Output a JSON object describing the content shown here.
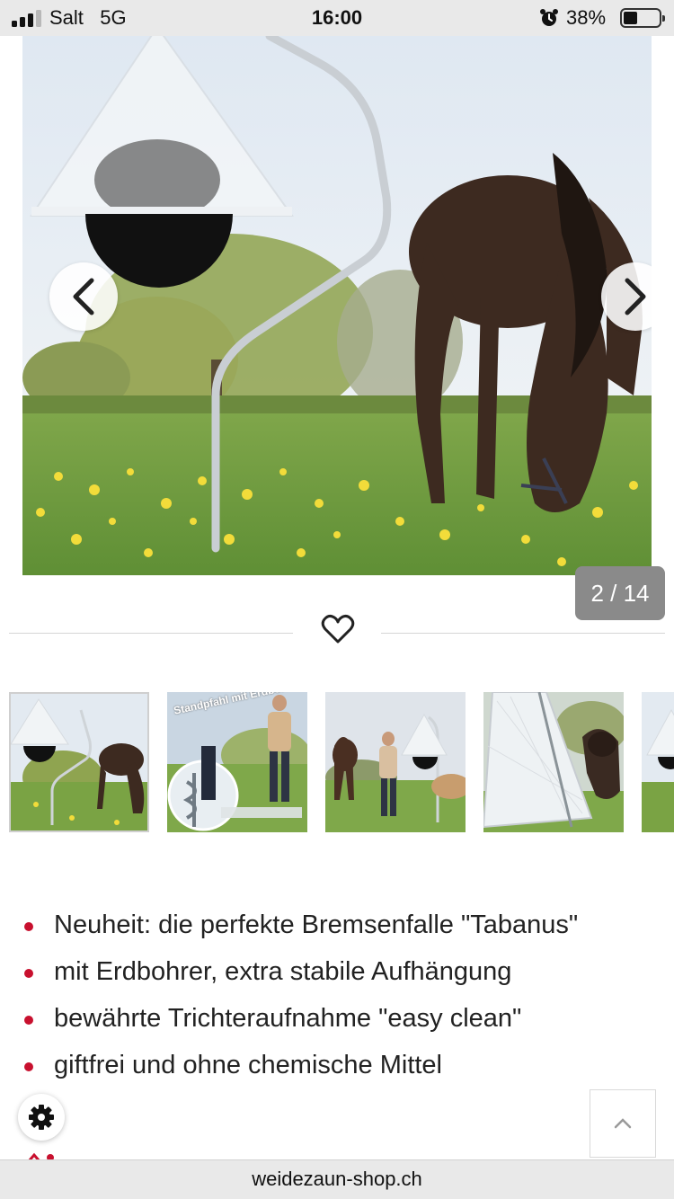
{
  "status_bar": {
    "carrier": "Salt",
    "network": "5G",
    "time": "16:00",
    "battery_percent": "38%",
    "battery_level": 0.38,
    "signal_bars_active": 3,
    "icons": [
      "signal-icon",
      "alarm-icon",
      "battery-icon"
    ]
  },
  "gallery": {
    "counter": "2 / 14",
    "current_index": 2,
    "total": 14,
    "icons": {
      "prev": "chevron-left-icon",
      "next": "chevron-right-icon",
      "favorite": "heart-icon"
    }
  },
  "thumbnails": [
    {
      "caption": ""
    },
    {
      "caption": "Standpfahl mit Erdbohrer!"
    },
    {
      "caption": ""
    },
    {
      "caption": ""
    },
    {
      "caption": ""
    }
  ],
  "features": [
    "Neuheit: die perfekte Bremsenfalle \"Tabanus\"",
    "mit Erdbohrer, extra stabile Aufhängung",
    "bewährte Trichteraufnahme \"easy clean\"",
    "giftfrei und ohne chemische Mittel"
  ],
  "floating": {
    "settings_icon": "gear-icon",
    "scroll_top_icon": "chevron-up-icon"
  },
  "browser": {
    "url": "weidezaun-shop.ch"
  },
  "colors": {
    "bullet": "#c8102e",
    "bar_background": "#e9e9e9",
    "counter_background": "#8a8a8a"
  }
}
